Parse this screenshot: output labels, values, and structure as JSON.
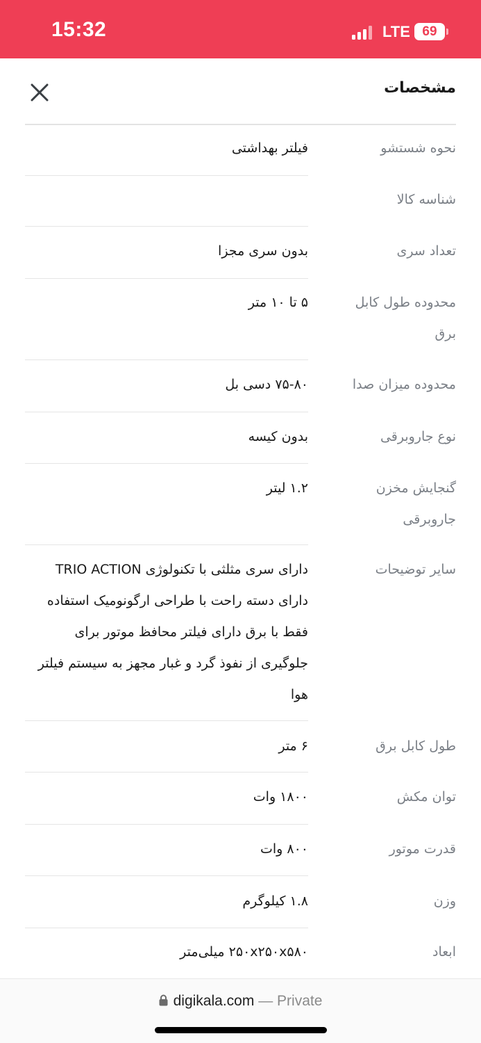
{
  "status_bar": {
    "time": "15:32",
    "network": "LTE",
    "battery": "69",
    "icons": [
      "signal-icon",
      "battery-icon"
    ]
  },
  "header": {
    "title": "مشخصات",
    "close_icon": "close-icon"
  },
  "specs": [
    {
      "label": "نحوه شستشو",
      "value": "فیلتر بهداشتی"
    },
    {
      "label": "شناسه کالا",
      "value": ""
    },
    {
      "label": "تعداد سری",
      "value": "بدون سری مجزا"
    },
    {
      "label": "محدوده طول کابل برق",
      "value": "۵ تا ۱۰ متر"
    },
    {
      "label": "محدوده میزان صدا",
      "value": "۷۵-۸۰ دسی بل"
    },
    {
      "label": "نوع جاروبرقی",
      "value": "بدون کیسه"
    },
    {
      "label": "گنجایش مخزن جاروبرقی",
      "value": "۱.۲ لیتر"
    },
    {
      "label": "سایر توضیحات",
      "value": "دارای سری مثلثی با تکنولوژی TRIO ACTION دارای دسته راحت با طراحی ارگونومیک استفاده فقط با برق دارای فیلتر محافظ موتور برای جلوگیری از نفوذ گرد و غبار مجهز به سیستم فیلتر هوا"
    },
    {
      "label": "طول کابل برق",
      "value": "۶ متر"
    },
    {
      "label": "توان مکش",
      "value": "۱۸۰۰ وات"
    },
    {
      "label": "قدرت موتور",
      "value": "۸۰۰ وات"
    },
    {
      "label": "وزن",
      "value": "۱.۸ کیلوگرم"
    },
    {
      "label": "ابعاد",
      "value": "۲۵۰x۲۵۰x۵۸۰ میلی‌متر"
    }
  ],
  "browser": {
    "host": "digikala.com",
    "private_label": "— Private",
    "lock_icon": "lock-icon"
  },
  "colors": {
    "status_bar": "#ef3e55",
    "label_text": "#7a7f86",
    "value_text": "#1a1a1a",
    "divider": "#e5e5e5"
  }
}
